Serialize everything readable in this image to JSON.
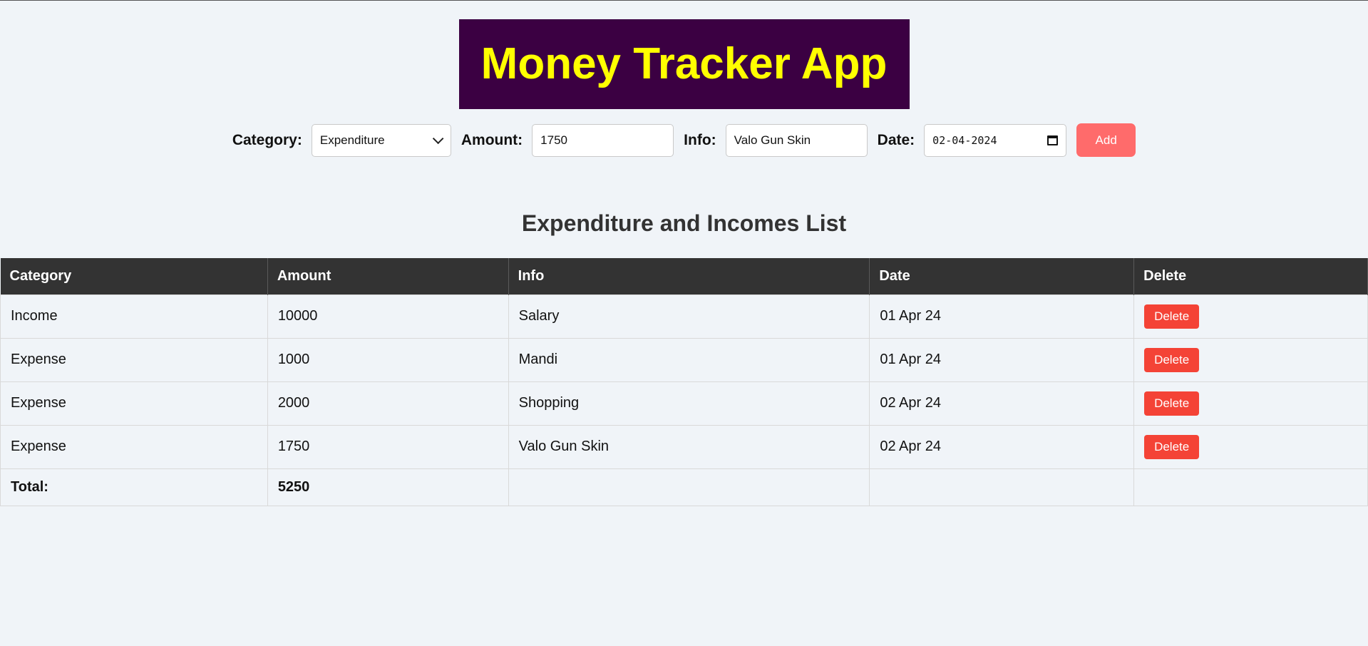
{
  "app": {
    "title": "Money Tracker App"
  },
  "form": {
    "category_label": "Category:",
    "category_value": "Expenditure",
    "amount_label": "Amount:",
    "amount_value": "1750",
    "info_label": "Info:",
    "info_value": "Valo Gun Skin",
    "date_label": "Date:",
    "date_value": "02-04-2024",
    "add_label": "Add"
  },
  "list": {
    "title": "Expenditure and Incomes List",
    "columns": [
      "Category",
      "Amount",
      "Info",
      "Date",
      "Delete"
    ],
    "rows": [
      {
        "category": "Income",
        "amount": "10000",
        "info": "Salary",
        "date": "01 Apr 24",
        "delete_label": "Delete"
      },
      {
        "category": "Expense",
        "amount": "1000",
        "info": "Mandi",
        "date": "01 Apr 24",
        "delete_label": "Delete"
      },
      {
        "category": "Expense",
        "amount": "2000",
        "info": "Shopping",
        "date": "02 Apr 24",
        "delete_label": "Delete"
      },
      {
        "category": "Expense",
        "amount": "1750",
        "info": "Valo Gun Skin",
        "date": "02 Apr 24",
        "delete_label": "Delete"
      }
    ],
    "total_label": "Total:",
    "total_value": "5250"
  },
  "colors": {
    "title_bg": "#3b0042",
    "title_text": "#ffff00",
    "add_button": "#ff6b6b",
    "delete_button": "#f44336",
    "table_header": "#333333",
    "page_bg": "#f0f4f8"
  }
}
